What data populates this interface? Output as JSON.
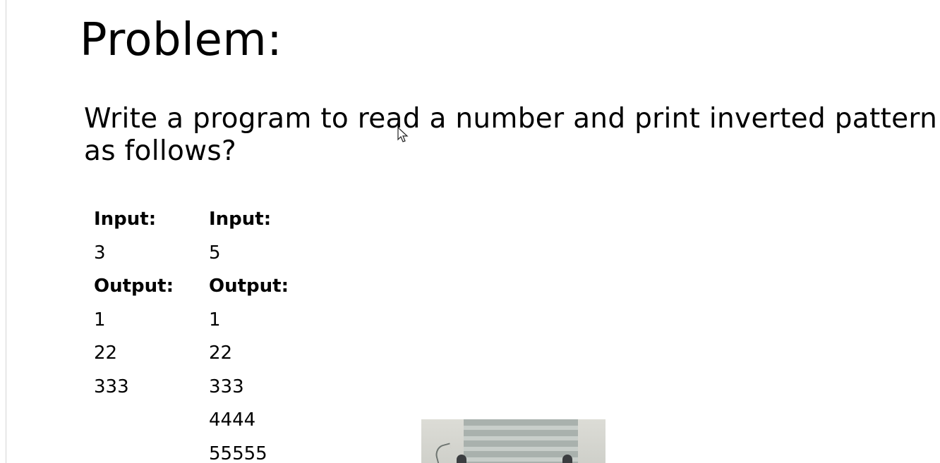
{
  "slide": {
    "title": "Problem:",
    "problem_text": "Write a program to read a number and print inverted pattern as follows?"
  },
  "examples": [
    {
      "input_label": "Input:",
      "input_value": "3",
      "output_label": "Output:",
      "output_lines": [
        "1",
        "22",
        "333"
      ]
    },
    {
      "input_label": "Input:",
      "input_value": "5",
      "output_label": "Output:",
      "output_lines": [
        "1",
        "22",
        "333",
        "4444",
        "55555"
      ]
    }
  ],
  "icons": {
    "cursor": "mouse-pointer-icon"
  },
  "colors": {
    "background": "#ffffff",
    "text": "#000000"
  }
}
